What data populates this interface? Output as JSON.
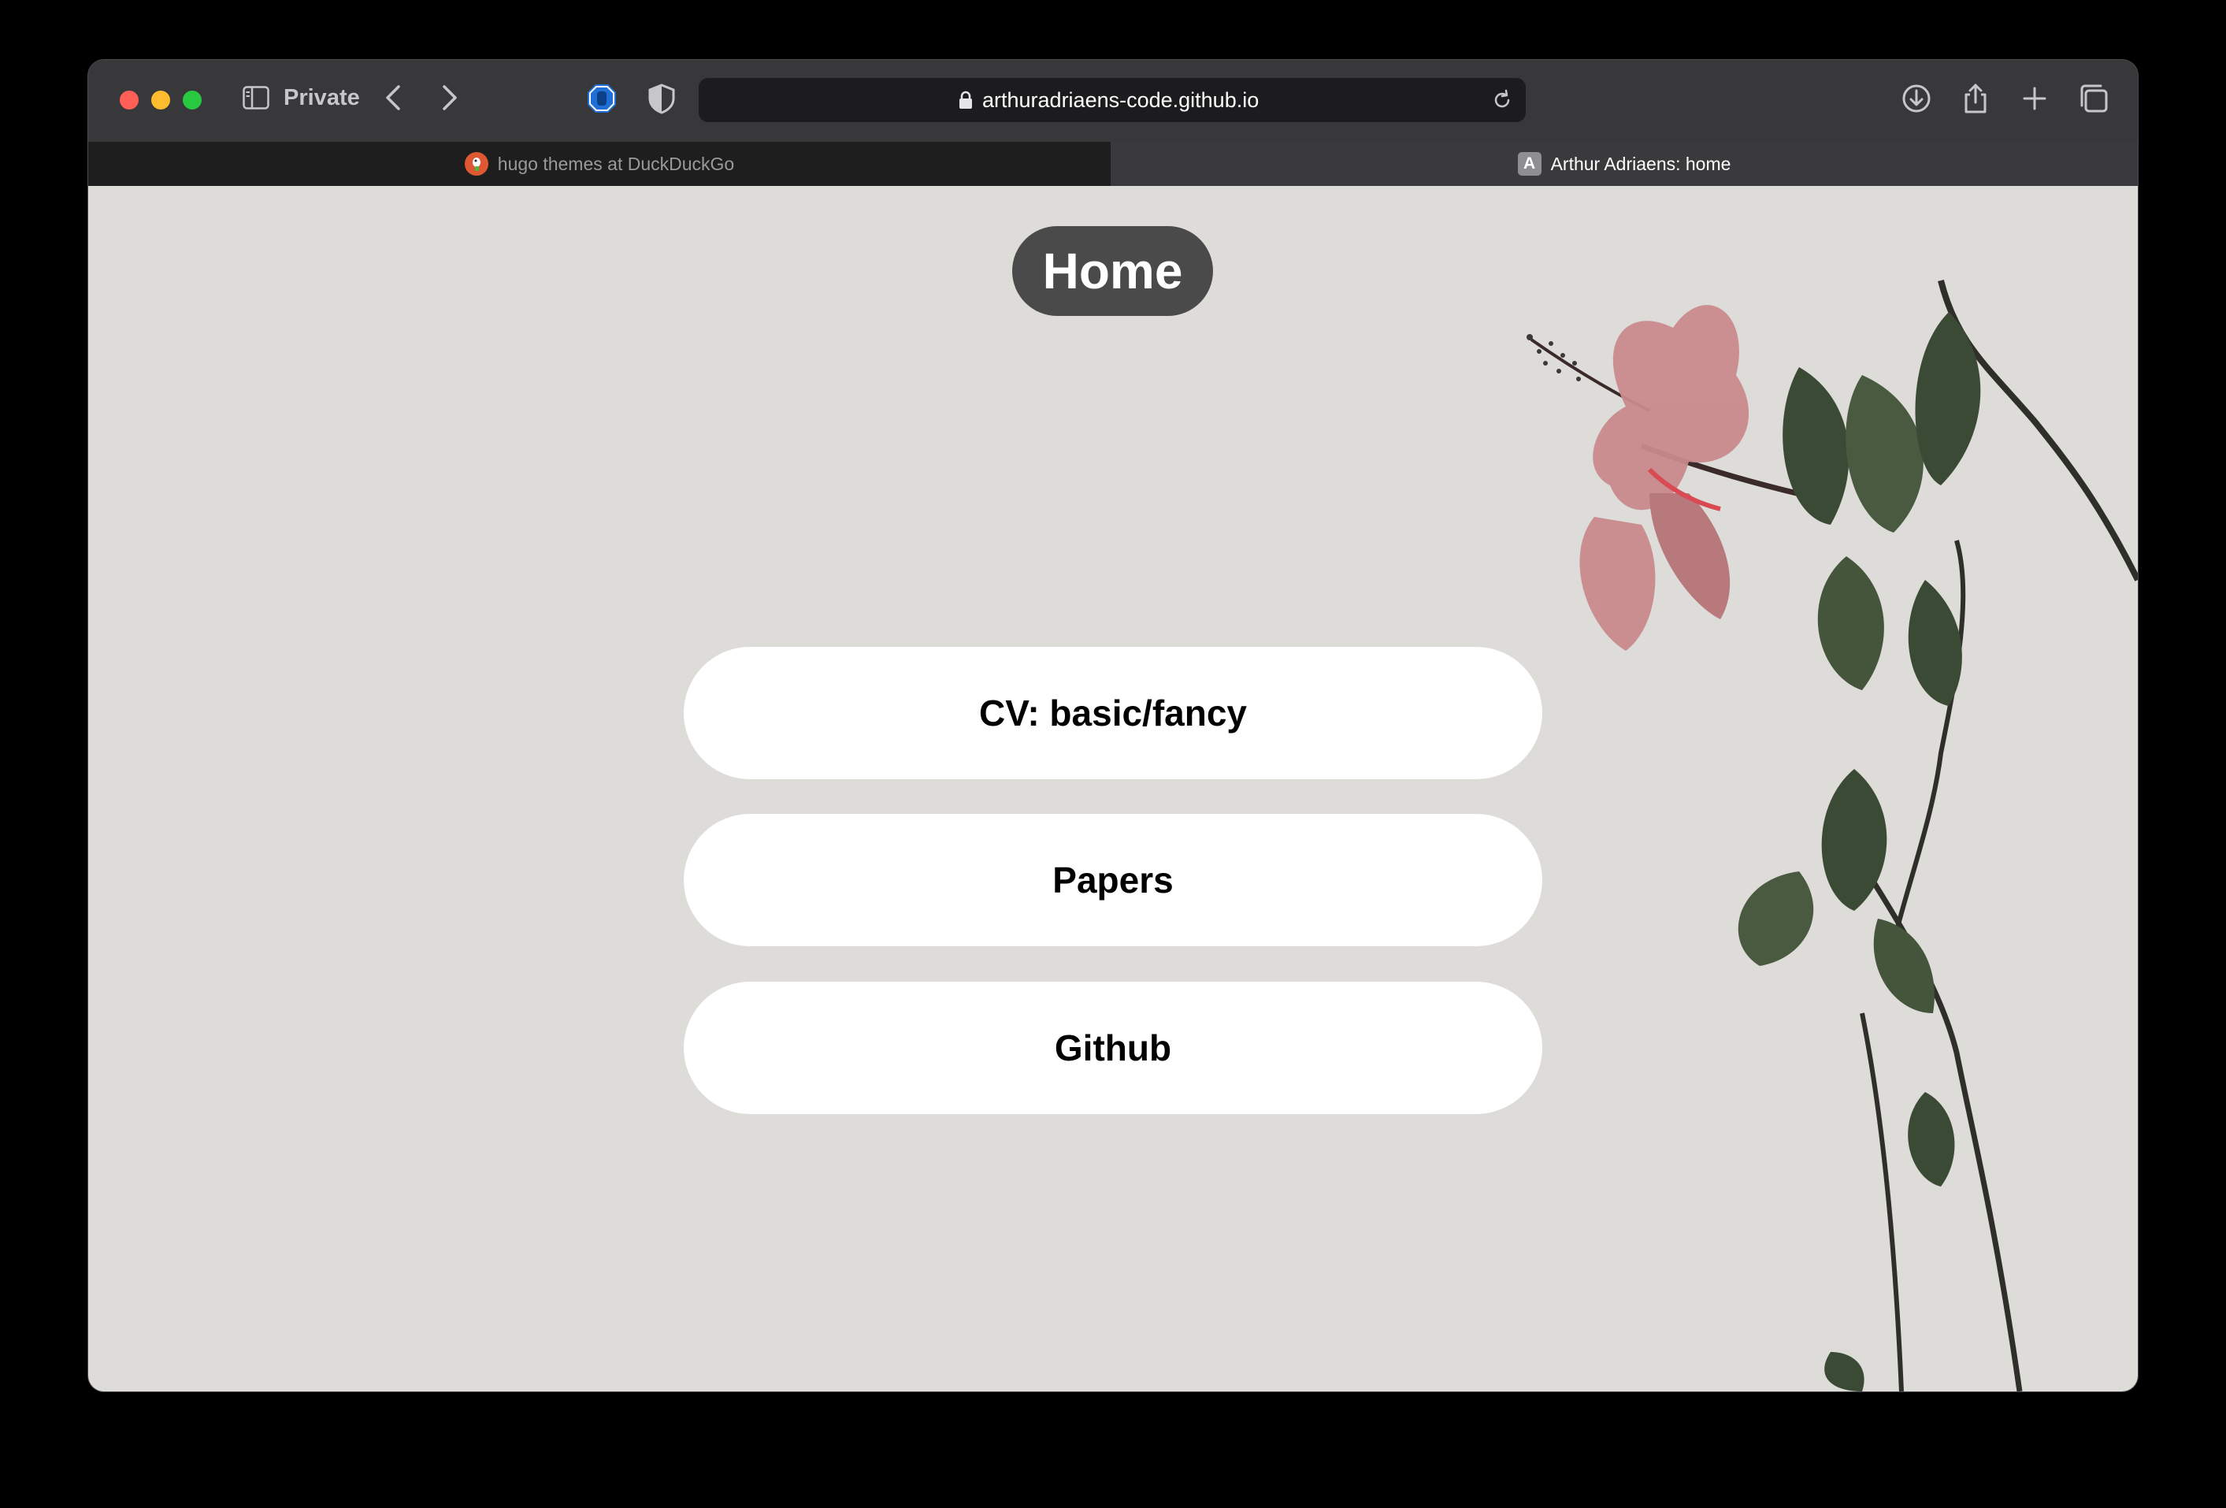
{
  "browser": {
    "mode_label": "Private",
    "url": "arthuradriaens-code.github.io",
    "tabs": [
      {
        "title": "hugo themes at DuckDuckGo",
        "favicon": "duckduckgo-icon",
        "active": false
      },
      {
        "title": "Arthur Adriaens: home",
        "favicon_letter": "A",
        "active": true
      }
    ]
  },
  "page": {
    "heading": "Home",
    "links": [
      {
        "label": "CV: basic/fancy"
      },
      {
        "label": "Papers"
      },
      {
        "label": "Github"
      }
    ]
  },
  "colors": {
    "page_background": "#dddcd8",
    "heading_pill": "#4a4a4a",
    "button_background": "#ffffff"
  }
}
